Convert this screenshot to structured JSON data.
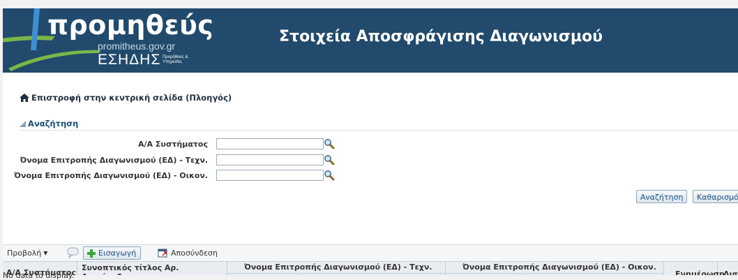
{
  "header": {
    "logo_word": "προμηθεύς",
    "logo_url": "promitheus.gov.gr",
    "logo_esidis": "ΕΣΗΔΗΣ",
    "logo_small": "Προμήθειες & Υπηρεσίες",
    "title": "Στοιχεία Αποσφράγισης Διαγωνισμού",
    "colors": {
      "header_bg": "#214a6c",
      "logo_green": "#7ab648",
      "logo_blue": "#3d8fd1"
    }
  },
  "nav": {
    "home_link": "Επιστροφή στην κεντρική σελίδα (Πλοηγός)",
    "home_icon": "home-icon"
  },
  "search": {
    "section_title": "Αναζήτηση",
    "fields": [
      {
        "label": "Α/Α Συστήματος",
        "value": ""
      },
      {
        "label": "Όνομα Επιτροπής Διαγωνισμού (ΕΔ) - Τεχν.",
        "value": ""
      },
      {
        "label": "Όνομα Επιτροπής Διαγωνισμού (ΕΔ) - Οικον.",
        "value": ""
      }
    ],
    "search_button": "Αναζήτηση",
    "clear_button": "Καθαρισμός"
  },
  "toolbar": {
    "view_label": "Προβολή",
    "insert_label": "Εισαγωγή",
    "detach_label": "Αποσύνδεση"
  },
  "table": {
    "columns": {
      "system_id": "Α/Α Συστήματος",
      "short_title": "Συνοπτικός τίτλος Αρ. Διακήρυξης",
      "tech_committee": "Όνομα Επιτροπής Διαγωνισμού (ΕΔ) - Τεχν.",
      "econ_committee": "Όνομα Επιτροπής Διαγωνισμού (ΕΔ) - Οικον.",
      "update": "Ενημέρωση",
      "delete": "Διαγ"
    },
    "empty_message": "No data to display."
  }
}
